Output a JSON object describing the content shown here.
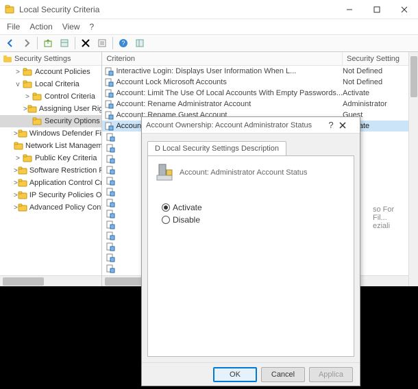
{
  "window": {
    "title": "Local Security Criteria"
  },
  "menu": {
    "file": "File",
    "action": "Action",
    "view": "View",
    "help": "?"
  },
  "tree": {
    "head": "Security Settings",
    "items": [
      {
        "label": "Account Policies",
        "indent": 2,
        "exp": ">"
      },
      {
        "label": "Local Criteria",
        "indent": 2,
        "exp": "v"
      },
      {
        "label": "Control Criteria",
        "indent": 3,
        "exp": ">"
      },
      {
        "label": "Assigning User Rights",
        "indent": 3,
        "exp": ">"
      },
      {
        "label": "Security Options",
        "indent": 3,
        "exp": "",
        "sel": true
      },
      {
        "label": "Windows Defender Firewall With Secure",
        "indent": 2,
        "exp": ">"
      },
      {
        "label": "Network List Management Policies",
        "indent": 2,
        "exp": ""
      },
      {
        "label": "Public Key Criteria",
        "indent": 2,
        "exp": ">"
      },
      {
        "label": "Software Restriction Policy",
        "indent": 2,
        "exp": ">"
      },
      {
        "label": "Application Control Criteria",
        "indent": 2,
        "exp": ">"
      },
      {
        "label": "IP Security Policies On LoC Computers",
        "indent": 2,
        "exp": ">"
      },
      {
        "label": "Advanced Policy Configuration",
        "indent": 2,
        "exp": ">"
      }
    ]
  },
  "list": {
    "col_criterion": "Criterion",
    "col_setting": "Security Setting",
    "rows": [
      {
        "label": "Interactive Login: Displays User Information When L...",
        "value": "Not Defined"
      },
      {
        "label": "Account Lock Microsoft Accounts",
        "value": "Not Defined"
      },
      {
        "label": "Account: Limit The Use Of Local Accounts With Empty Passwords...",
        "value": "Activate"
      },
      {
        "label": "Account: Rename Administrator Account",
        "value": "Administrator"
      },
      {
        "label": "Account: Rename Guest Account",
        "value": "Guest"
      },
      {
        "label": "Account: Administrator Account Status",
        "value": "Activate",
        "sel": true
      }
    ],
    "tail1": "so For Fil...",
    "tail2": "eziali"
  },
  "dialog": {
    "title": "Account Ownership: Account Administrator Status",
    "tab": "D Local Security Settings Description",
    "desc": "Account: Administrator Account Status",
    "opt_activate": "Activate",
    "opt_disable": "Disable",
    "btn_ok": "OK",
    "btn_cancel": "Cancel",
    "btn_apply": "Applica"
  }
}
